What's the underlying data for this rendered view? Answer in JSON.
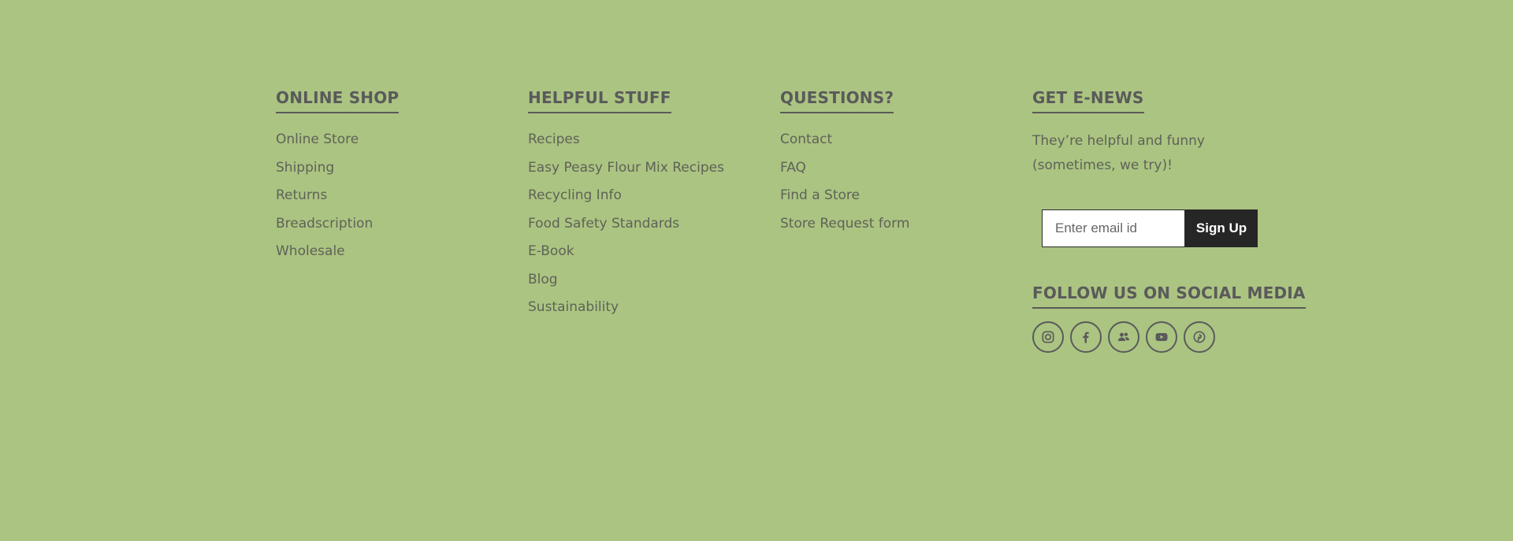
{
  "shop": {
    "heading": "ONLINE SHOP",
    "links": [
      "Online Store",
      "Shipping",
      "Returns",
      "Breadscription",
      "Wholesale"
    ]
  },
  "helpful": {
    "heading": "HELPFUL STUFF",
    "links": [
      "Recipes",
      "Easy Peasy Flour Mix Recipes",
      "Recycling Info",
      "Food Safety Standards",
      "E-Book",
      "Blog",
      "Sustainability"
    ]
  },
  "questions": {
    "heading": "QUESTIONS?",
    "links": [
      "Contact",
      "FAQ",
      "Find a Store",
      "Store Request form"
    ]
  },
  "enews": {
    "heading": "GET E-NEWS",
    "text": "They’re helpful and funny (sometimes, we try)!",
    "email_placeholder": "Enter email id",
    "signup_label": "Sign Up"
  },
  "social": {
    "heading": "FOLLOW US ON SOCIAL MEDIA",
    "icons": [
      "instagram-icon",
      "facebook-icon",
      "community-icon",
      "youtube-icon",
      "pinterest-icon"
    ]
  },
  "colors": {
    "background": "#abc482",
    "text": "#5a5a5a",
    "button": "#262626"
  }
}
